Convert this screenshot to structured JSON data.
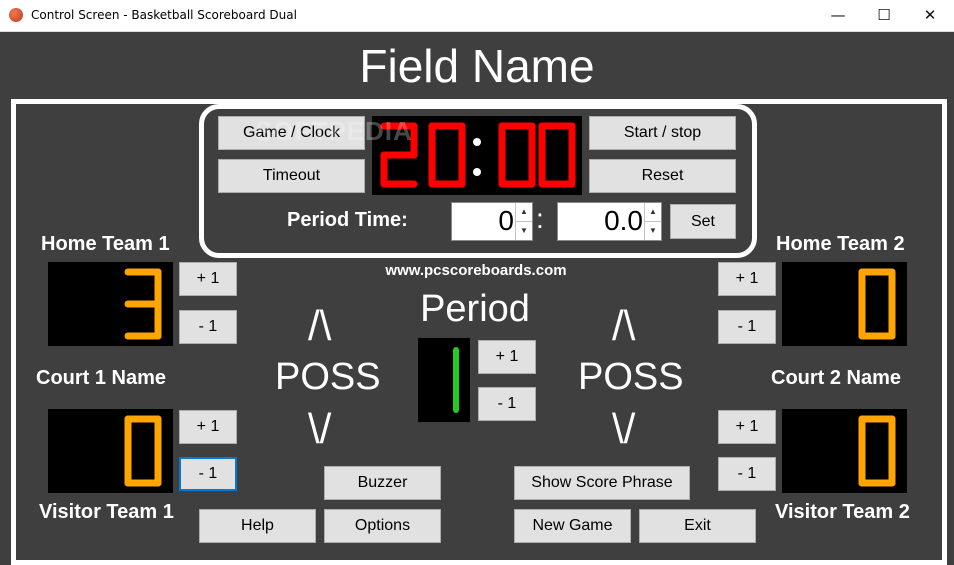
{
  "window": {
    "title": "Control Screen - Basketball Scoreboard Dual",
    "minimize": "—",
    "maximize": "☐",
    "close": "✕"
  },
  "field_name": "Field Name",
  "clock": {
    "game_clock_button": "Game / Clock",
    "timeout_button": "Timeout",
    "start_stop_button": "Start / stop",
    "reset_button": "Reset",
    "display": "20:00",
    "period_time_label": "Period Time:",
    "minutes_value": "0",
    "seconds_value": "0.0",
    "colon": ":",
    "set_button": "Set",
    "watermark": "SOFTPEDIA"
  },
  "url": "www.pcscoreboards.com",
  "period": {
    "label": "Period",
    "value": "1",
    "plus": "+ 1",
    "minus": "- 1"
  },
  "court1": {
    "home_name": "Home Team 1",
    "home_score": "3",
    "court_name": "Court 1 Name",
    "visitor_score": "0",
    "visitor_name": "Visitor Team 1",
    "poss_label": "POSS",
    "poss_up": "/\\",
    "poss_down": "\\/"
  },
  "court2": {
    "home_name": "Home Team 2",
    "home_score": "0",
    "court_name": "Court 2 Name",
    "visitor_score": "0",
    "visitor_name": "Visitor Team 2",
    "poss_label": "POSS",
    "poss_up": "/\\",
    "poss_down": "\\/"
  },
  "score_buttons": {
    "plus": "+ 1",
    "minus": "- 1"
  },
  "bottom": {
    "buzzer": "Buzzer",
    "show_score_phrase": "Show Score Phrase",
    "help": "Help",
    "options": "Options",
    "new_game": "New Game",
    "exit": "Exit"
  },
  "colors": {
    "background": "#3f3f3f",
    "clock_digit": "#ff0000",
    "score_digit": "#ffa500",
    "period_digit": "#22cc22"
  }
}
